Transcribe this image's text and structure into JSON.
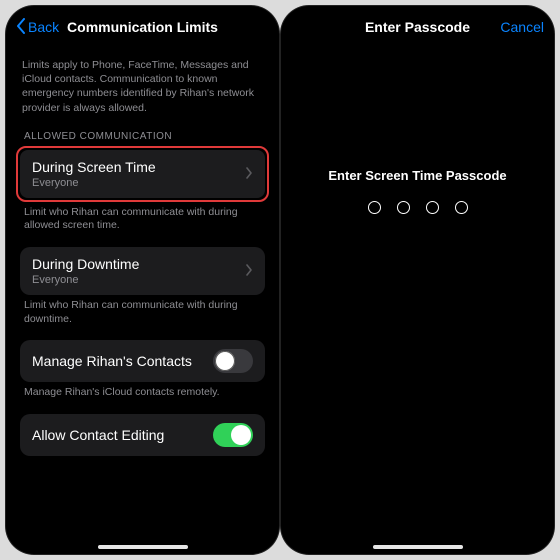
{
  "left": {
    "nav": {
      "back": "Back",
      "title": "Communication Limits"
    },
    "intro": "Limits apply to Phone, FaceTime, Messages and iCloud contacts. Communication to known emergency numbers identified by Rihan's network provider is always allowed.",
    "groupHeader": "ALLOWED COMMUNICATION",
    "screenTime": {
      "title": "During Screen Time",
      "sub": "Everyone"
    },
    "screenTimeFooter": "Limit who Rihan can communicate with during allowed screen time.",
    "downtime": {
      "title": "During Downtime",
      "sub": "Everyone"
    },
    "downtimeFooter": "Limit who Rihan can communicate with during downtime.",
    "manageContacts": {
      "title": "Manage Rihan's Contacts",
      "on": false
    },
    "manageContactsFooter": "Manage Rihan's iCloud contacts remotely.",
    "allowEditing": {
      "title": "Allow Contact Editing",
      "on": true
    }
  },
  "right": {
    "nav": {
      "title": "Enter Passcode",
      "cancel": "Cancel"
    },
    "prompt": "Enter Screen Time Passcode",
    "digits": 4
  }
}
